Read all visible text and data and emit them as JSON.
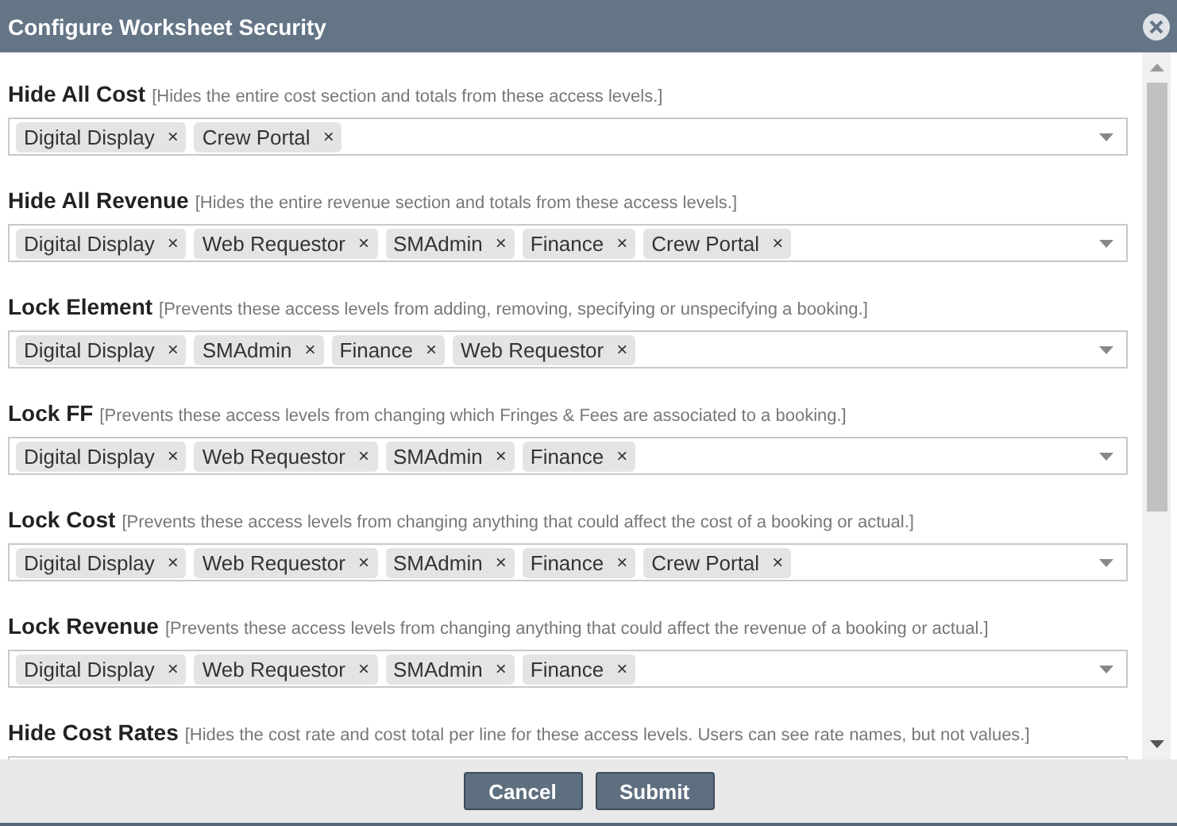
{
  "window": {
    "title": "Configure Worksheet Security"
  },
  "sections": [
    {
      "label": "Hide All Cost",
      "description": "[Hides the entire cost section and totals from these access levels.]",
      "tags": [
        {
          "text": "Digital Display",
          "remove": "×"
        },
        {
          "text": "Crew Portal",
          "remove": "×"
        }
      ]
    },
    {
      "label": "Hide All Revenue",
      "description": "[Hides the entire revenue section and totals from these access levels.]",
      "tags": [
        {
          "text": "Digital Display",
          "remove": "×"
        },
        {
          "text": "Web Requestor",
          "remove": "×"
        },
        {
          "text": "SMAdmin",
          "remove": "×"
        },
        {
          "text": "Finance",
          "remove": "×"
        },
        {
          "text": "Crew Portal",
          "remove": "×"
        }
      ]
    },
    {
      "label": "Lock Element",
      "description": "[Prevents these access levels from adding, removing, specifying or unspecifying a booking.]",
      "tags": [
        {
          "text": "Digital Display",
          "remove": "×"
        },
        {
          "text": "SMAdmin",
          "remove": "×"
        },
        {
          "text": "Finance",
          "remove": "×"
        },
        {
          "text": "Web Requestor",
          "remove": "×"
        }
      ]
    },
    {
      "label": "Lock FF",
      "description": "[Prevents these access levels from changing which Fringes & Fees are associated to a booking.]",
      "tags": [
        {
          "text": "Digital Display",
          "remove": "×"
        },
        {
          "text": "Web Requestor",
          "remove": "×"
        },
        {
          "text": "SMAdmin",
          "remove": "×"
        },
        {
          "text": "Finance",
          "remove": "×"
        }
      ]
    },
    {
      "label": "Lock Cost",
      "description": "[Prevents these access levels from changing anything that could affect the cost of a booking or actual.]",
      "tags": [
        {
          "text": "Digital Display",
          "remove": "×"
        },
        {
          "text": "Web Requestor",
          "remove": "×"
        },
        {
          "text": "SMAdmin",
          "remove": "×"
        },
        {
          "text": "Finance",
          "remove": "×"
        },
        {
          "text": "Crew Portal",
          "remove": "×"
        }
      ]
    },
    {
      "label": "Lock Revenue",
      "description": "[Prevents these access levels from changing anything that could affect the revenue of a booking or actual.]",
      "tags": [
        {
          "text": "Digital Display",
          "remove": "×"
        },
        {
          "text": "Web Requestor",
          "remove": "×"
        },
        {
          "text": "SMAdmin",
          "remove": "×"
        },
        {
          "text": "Finance",
          "remove": "×"
        }
      ]
    },
    {
      "label": "Hide Cost Rates",
      "description": "[Hides the cost rate and cost total per line for these access levels. Users can see rate names, but not values.]"
    }
  ],
  "buttons": [
    "Cancel",
    "Submit"
  ]
}
